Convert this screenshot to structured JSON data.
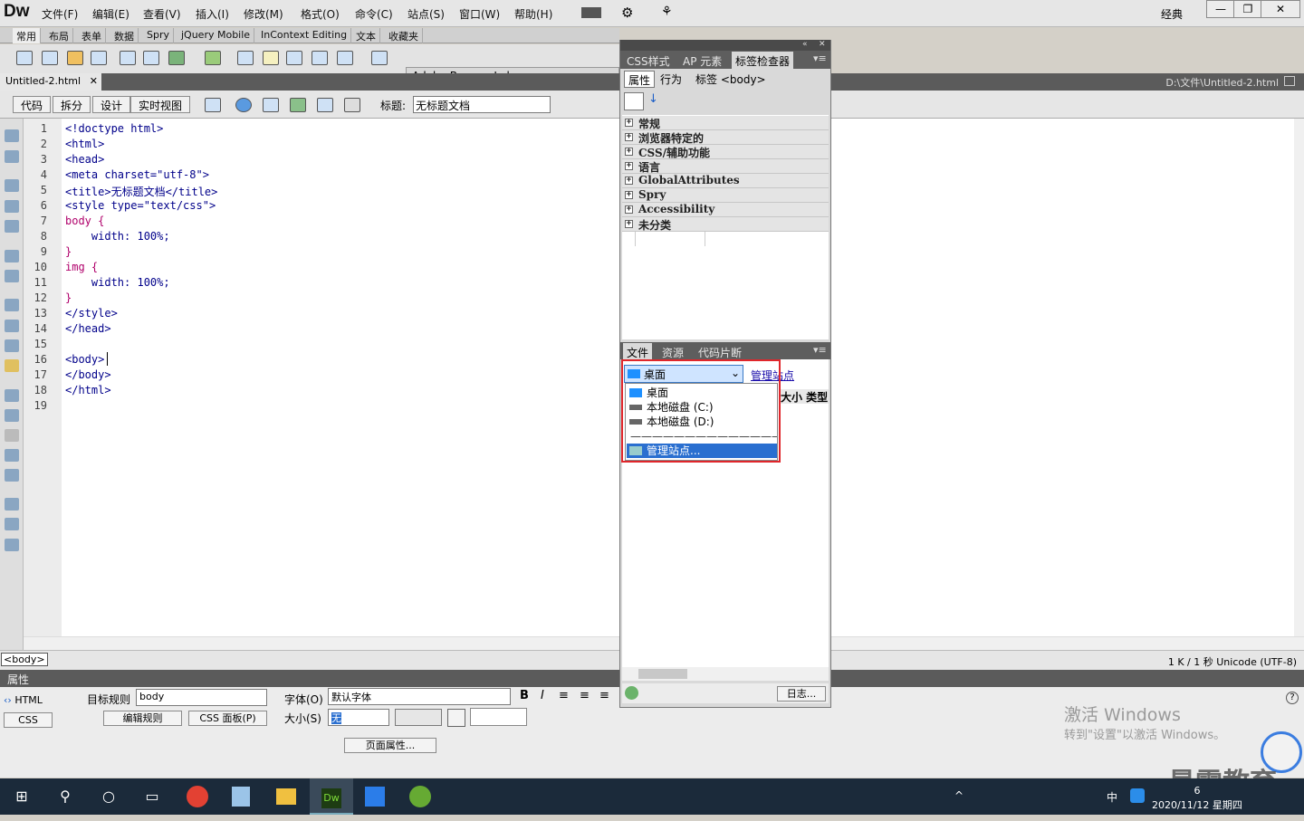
{
  "app": {
    "logo": "Dw",
    "layout": "经典"
  },
  "menu": [
    "文件(F)",
    "编辑(E)",
    "查看(V)",
    "插入(I)",
    "修改(M)",
    "格式(O)",
    "命令(C)",
    "站点(S)",
    "窗口(W)",
    "帮助(H)"
  ],
  "insert_tabs": [
    "常用",
    "布局",
    "表单",
    "数据",
    "Spry",
    "jQuery Mobile",
    "InContext Editing",
    "文本",
    "收藏夹"
  ],
  "browserlab": "Adobe BrowserLab",
  "document": {
    "tab": "Untitled-2.html",
    "path": "D:\\文件\\Untitled-2.html",
    "views": [
      "代码",
      "拆分",
      "设计",
      "实时视图"
    ],
    "title_label": "标题:",
    "title_value": "无标题文档"
  },
  "code_lines": [
    {
      "n": "1",
      "t": "<!doctype html>",
      "c": "tag"
    },
    {
      "n": "2",
      "t": "<html>",
      "c": "tag"
    },
    {
      "n": "3",
      "t": "<head>",
      "c": "tag"
    },
    {
      "n": "4",
      "t": "<meta charset=\"utf-8\">",
      "c": "tag"
    },
    {
      "n": "5",
      "t": "<title>无标题文档</title>",
      "c": "tag"
    },
    {
      "n": "6",
      "t": "<style type=\"text/css\">",
      "c": "tag"
    },
    {
      "n": "7",
      "t": "body {",
      "c": "sel"
    },
    {
      "n": "8",
      "t": "    width: 100%;",
      "c": "prop"
    },
    {
      "n": "9",
      "t": "}",
      "c": "sel"
    },
    {
      "n": "10",
      "t": "img {",
      "c": "sel"
    },
    {
      "n": "11",
      "t": "    width: 100%;",
      "c": "prop"
    },
    {
      "n": "12",
      "t": "}",
      "c": "sel"
    },
    {
      "n": "13",
      "t": "</style>",
      "c": "tag"
    },
    {
      "n": "14",
      "t": "</head>",
      "c": "tag"
    },
    {
      "n": "15",
      "t": "",
      "c": "tag"
    },
    {
      "n": "16",
      "t": "<body>",
      "c": "tag"
    },
    {
      "n": "17",
      "t": "</body>",
      "c": "tag"
    },
    {
      "n": "18",
      "t": "</html>",
      "c": "tag"
    },
    {
      "n": "19",
      "t": "",
      "c": "tag"
    }
  ],
  "status": {
    "tag": "<body>",
    "info": "1 K / 1 秒 Unicode (UTF-8)"
  },
  "panel": {
    "tabs1": [
      "CSS样式",
      "AP 元素",
      "标签检查器"
    ],
    "sub_tabs": [
      "属性",
      "行为"
    ],
    "tag_label": "标签 <body>",
    "categories": [
      "常规",
      "浏览器特定的",
      "CSS/辅助功能",
      "语言",
      "GlobalAttributes",
      "Spry",
      "Accessibility",
      "未分类"
    ],
    "tabs2": [
      "文件",
      "资源",
      "代码片断"
    ],
    "site_value": "桌面",
    "manage_link": "管理站点",
    "dropdown": [
      "桌面",
      "本地磁盘 (C:)",
      "本地磁盘 (D:)",
      "——————————————",
      "管理站点..."
    ],
    "col_headers": "大小 类型",
    "log_button": "日志..."
  },
  "properties": {
    "title": "属性",
    "html_btn": "HTML",
    "css_btn": "CSS",
    "target_rule_label": "目标规则",
    "target_rule_value": "body",
    "edit_rule": "编辑规则",
    "css_panel": "CSS 面板(P)",
    "font_label": "字体(O)",
    "font_value": "默认字体",
    "size_label": "大小(S)",
    "size_value": "无",
    "page_props": "页面属性..."
  },
  "watermark": {
    "line1": "激活 Windows",
    "line2": "转到\"设置\"以激活 Windows。",
    "brand": "最需教育"
  },
  "taskbar": {
    "time": "6",
    "date": "2020/11/12 星期四",
    "ime": "中"
  }
}
